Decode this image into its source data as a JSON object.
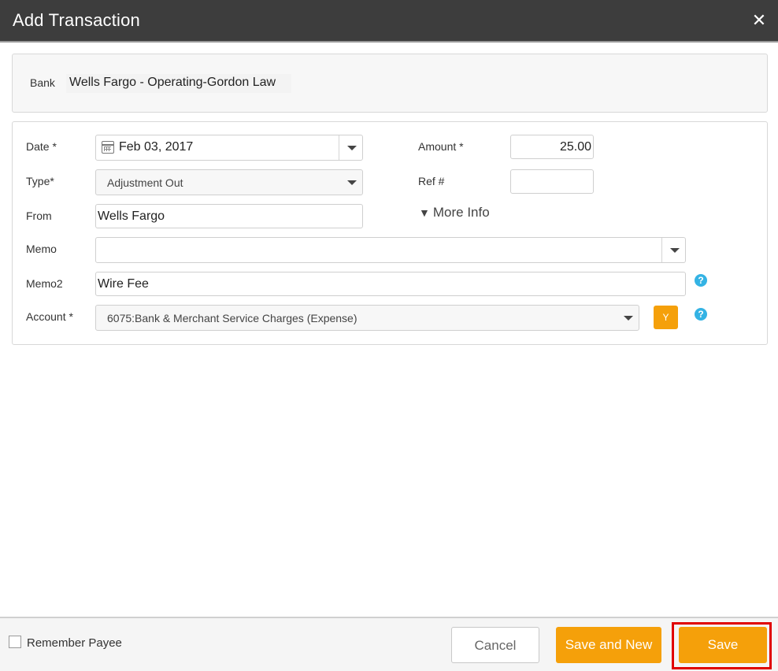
{
  "dialog": {
    "title": "Add Transaction",
    "close_glyph": "✕"
  },
  "bank": {
    "label": "Bank",
    "value": "Wells Fargo - Operating-Gordon Law"
  },
  "form": {
    "date": {
      "label": "Date *",
      "value": "Feb 03, 2017"
    },
    "type": {
      "label": "Type*",
      "value": "Adjustment Out"
    },
    "from": {
      "label": "From",
      "value": "Wells Fargo"
    },
    "memo": {
      "label": "Memo",
      "value": ""
    },
    "memo2": {
      "label": "Memo2",
      "value": "Wire Fee"
    },
    "account": {
      "label": "Account *",
      "value": "6075:Bank & Merchant Service Charges (Expense)",
      "tag_button": "Y"
    },
    "amount": {
      "label": "Amount *",
      "value": "25.00"
    },
    "ref": {
      "label": "Ref #",
      "value": ""
    },
    "more_info": "More Info",
    "help_glyph": "?"
  },
  "footer": {
    "remember_payee": "Remember Payee",
    "remember_checked": false,
    "cancel": "Cancel",
    "save_and_new": "Save and New",
    "save": "Save"
  },
  "colors": {
    "titlebar": "#3d3d3d",
    "accent": "#f5a00a",
    "help": "#34b3e4",
    "highlight": "#e00000"
  },
  "icons": {
    "close": "close-icon",
    "calendar": "calendar-icon",
    "dropdown": "chevron-down-icon",
    "help": "help-icon",
    "more_info": "triangle-down-icon"
  }
}
